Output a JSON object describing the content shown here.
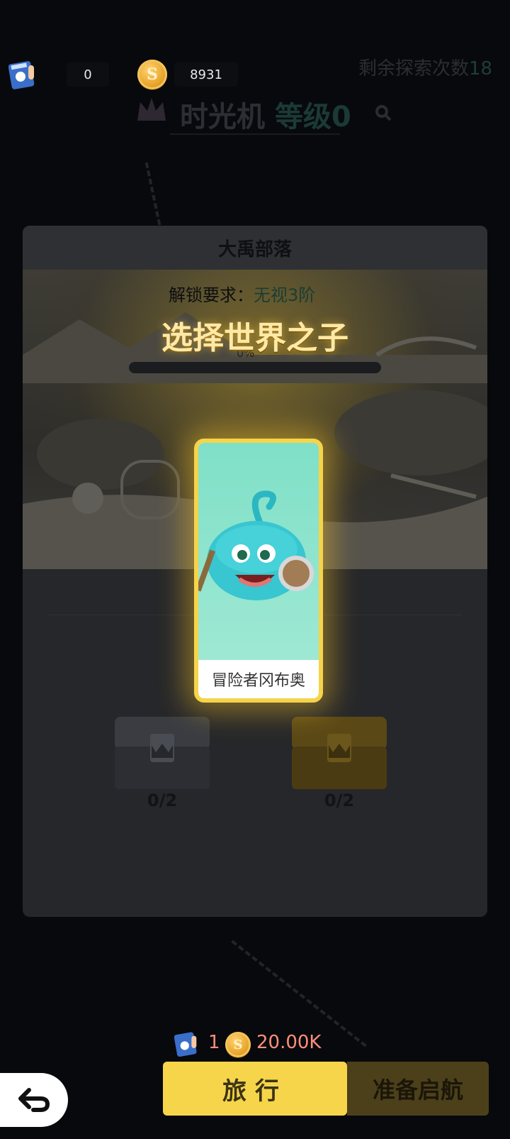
{
  "top_bar": {
    "tickets": "0",
    "coins": "8931",
    "explore_label": "剩余探索次数",
    "explore_count": "18"
  },
  "title": {
    "name": "时光机",
    "level": "等级0"
  },
  "panel": {
    "header": "大禹部落",
    "unlock_label": "解锁要求：",
    "unlock_value": "无视3阶",
    "progress_text": "0%"
  },
  "selection": {
    "title": "选择世界之子",
    "card_name": "冒险者冈布奥"
  },
  "chests": [
    {
      "progress": "0/2"
    },
    {
      "progress": "0/2"
    }
  ],
  "cost": {
    "tickets": "1",
    "coins": "20.00K"
  },
  "buttons": {
    "travel": "旅行",
    "launch": "准备启航"
  },
  "colors": {
    "accent_yellow": "#f6d54a",
    "cost_red": "#ff8f7a"
  }
}
